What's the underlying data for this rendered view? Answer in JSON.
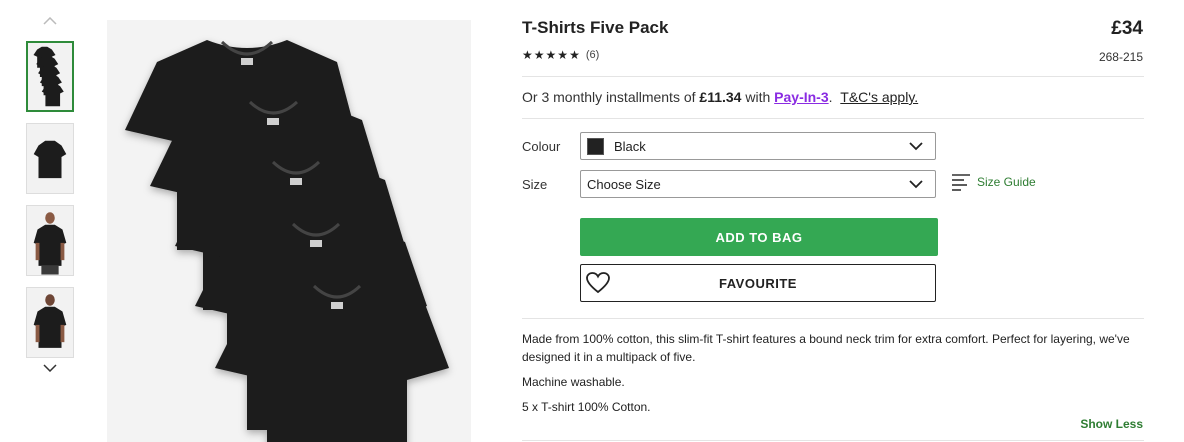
{
  "product": {
    "title": "T-Shirts Five Pack",
    "price": "£34",
    "rating_stars": 5,
    "review_count": "(6)",
    "item_code": "268-215"
  },
  "payment": {
    "prefix": "Or 3 monthly installments of",
    "amount": "£11.34",
    "with_text": "with",
    "link_text": "Pay-In-3",
    "tc_text": "T&C's apply."
  },
  "options": {
    "colour_label": "Colour",
    "colour_value": "Black",
    "colour_swatch": "#222222",
    "size_label": "Size",
    "size_value": "Choose Size",
    "size_guide": "Size Guide"
  },
  "actions": {
    "add_to_bag": "ADD TO BAG",
    "favourite": "FAVOURITE",
    "accent_color": "#34a853"
  },
  "description": {
    "paragraph1": "Made from 100% cotton, this slim-fit T-shirt features a bound neck trim for extra comfort. Perfect for layering, we've designed it in a multipack of five.",
    "paragraph2": "Machine washable.",
    "paragraph3": "5 x T-shirt 100% Cotton.",
    "show_less": "Show Less"
  },
  "gallery": {
    "thumbnails": [
      "five-pack-flat",
      "single-tee-flat",
      "model-front",
      "model-back"
    ],
    "selected_index": 0
  }
}
